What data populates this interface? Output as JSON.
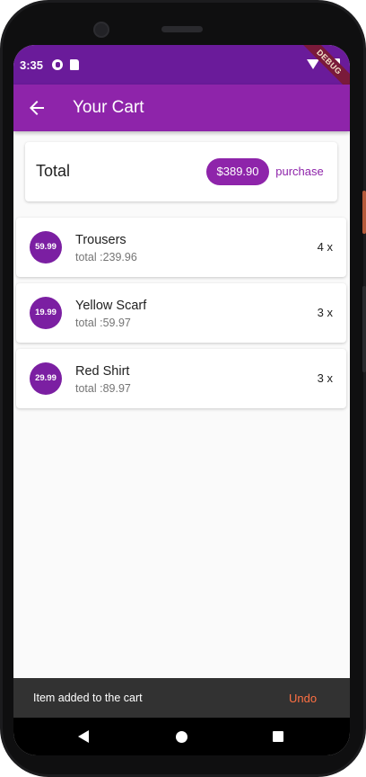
{
  "status_bar": {
    "time": "3:35",
    "icons": [
      "data-saver-icon",
      "sd-card-icon",
      "wifi-icon",
      "battery-icon"
    ],
    "debug_banner": "DEBUG"
  },
  "app_bar": {
    "title": "Your Cart",
    "back_icon": "arrow-back-icon",
    "background": "#8e24aa"
  },
  "total_card": {
    "label": "Total",
    "amount": "$389.90",
    "purchase_label": "purchase"
  },
  "items": [
    {
      "price": "59.99",
      "name": "Trousers",
      "total": "total :239.96",
      "qty": "4 x"
    },
    {
      "price": "19.99",
      "name": "Yellow Scarf",
      "total": "total :59.97",
      "qty": "3 x"
    },
    {
      "price": "29.99",
      "name": "Red Shirt",
      "total": "total :89.97",
      "qty": "3 x"
    }
  ],
  "snackbar": {
    "message": "Item added to the cart",
    "action": "Undo",
    "action_color": "#ff7043"
  },
  "nav_bar": {
    "icons": [
      "nav-back-icon",
      "nav-home-icon",
      "nav-recents-icon"
    ]
  },
  "colors": {
    "primary": "#8e24aa",
    "primary_dark": "#6a1b9a",
    "avatar": "#7b1fa2"
  }
}
